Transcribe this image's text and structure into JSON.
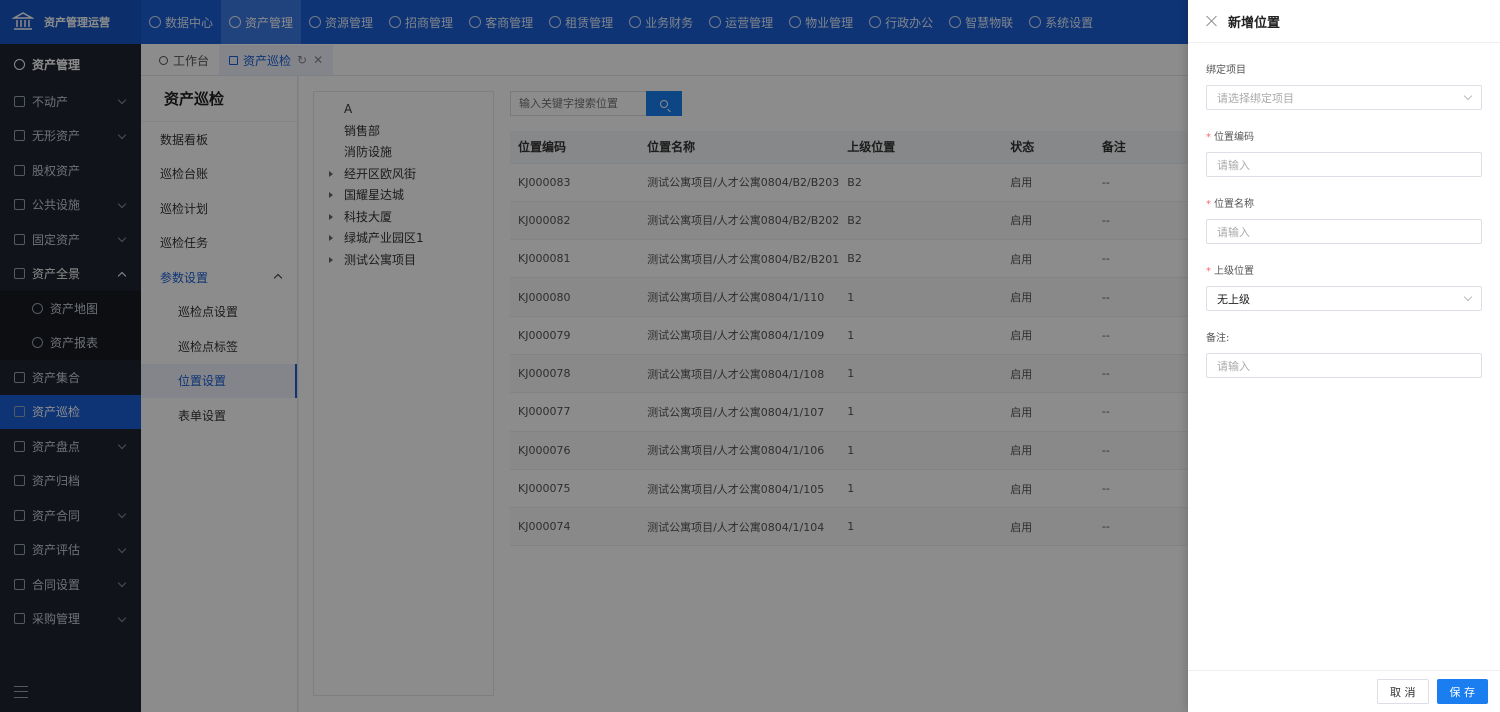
{
  "brand": "资产管理运营",
  "topnav": [
    "数据中心",
    "资产管理",
    "资源管理",
    "招商管理",
    "客商管理",
    "租赁管理",
    "业务财务",
    "运营管理",
    "物业管理",
    "行政办公",
    "智慧物联",
    "系统设置"
  ],
  "topnav_active": "资产管理",
  "sidebar": {
    "header": "资产管理",
    "items": [
      {
        "label": "不动产",
        "chev": true
      },
      {
        "label": "无形资产",
        "chev": true
      },
      {
        "label": "股权资产"
      },
      {
        "label": "公共设施",
        "chev": true
      },
      {
        "label": "固定资产",
        "chev": true
      },
      {
        "label": "资产全景",
        "chev": true,
        "open": true
      },
      {
        "label": "资产地图",
        "sub": true
      },
      {
        "label": "资产报表",
        "sub": true
      },
      {
        "label": "资产集合"
      },
      {
        "label": "资产巡检",
        "active": true
      },
      {
        "label": "资产盘点",
        "chev": true
      },
      {
        "label": "资产归档"
      },
      {
        "label": "资产合同",
        "chev": true
      },
      {
        "label": "资产评估",
        "chev": true
      },
      {
        "label": "合同设置",
        "chev": true
      },
      {
        "label": "采购管理",
        "chev": true
      }
    ]
  },
  "tabs": [
    {
      "label": "工作台"
    },
    {
      "label": "资产巡检",
      "active": true
    }
  ],
  "submenu": {
    "title": "资产巡检",
    "items": [
      {
        "label": "数据看板"
      },
      {
        "label": "巡检台账"
      },
      {
        "label": "巡检计划"
      },
      {
        "label": "巡检任务"
      },
      {
        "label": "参数设置",
        "group": true
      },
      {
        "label": "巡检点设置",
        "child": true
      },
      {
        "label": "巡检点标签",
        "child": true
      },
      {
        "label": "位置设置",
        "child": true,
        "active": true
      },
      {
        "label": "表单设置",
        "child": true
      }
    ]
  },
  "tree": [
    {
      "label": "A"
    },
    {
      "label": "销售部"
    },
    {
      "label": "消防设施"
    },
    {
      "label": "经开区欧风街",
      "exp": true
    },
    {
      "label": "国耀星达城",
      "exp": true
    },
    {
      "label": "科技大厦",
      "exp": true
    },
    {
      "label": "绿城产业园区1",
      "exp": true
    },
    {
      "label": "测试公寓项目",
      "exp": true
    }
  ],
  "search": {
    "placeholder": "输入关键字搜索位置"
  },
  "table": {
    "headers": [
      "位置编码",
      "位置名称",
      "上级位置",
      "状态",
      "备注"
    ],
    "rows": [
      [
        "KJ000083",
        "测试公寓项目/人才公寓0804/B2/B203",
        "B2",
        "启用",
        "--"
      ],
      [
        "KJ000082",
        "测试公寓项目/人才公寓0804/B2/B202",
        "B2",
        "启用",
        "--"
      ],
      [
        "KJ000081",
        "测试公寓项目/人才公寓0804/B2/B201",
        "B2",
        "启用",
        "--"
      ],
      [
        "KJ000080",
        "测试公寓项目/人才公寓0804/1/110",
        "1",
        "启用",
        "--"
      ],
      [
        "KJ000079",
        "测试公寓项目/人才公寓0804/1/109",
        "1",
        "启用",
        "--"
      ],
      [
        "KJ000078",
        "测试公寓项目/人才公寓0804/1/108",
        "1",
        "启用",
        "--"
      ],
      [
        "KJ000077",
        "测试公寓项目/人才公寓0804/1/107",
        "1",
        "启用",
        "--"
      ],
      [
        "KJ000076",
        "测试公寓项目/人才公寓0804/1/106",
        "1",
        "启用",
        "--"
      ],
      [
        "KJ000075",
        "测试公寓项目/人才公寓0804/1/105",
        "1",
        "启用",
        "--"
      ],
      [
        "KJ000074",
        "测试公寓项目/人才公寓0804/1/104",
        "1",
        "启用",
        "--"
      ]
    ]
  },
  "drawer": {
    "title": "新增位置",
    "fields": [
      {
        "label": "绑定项目",
        "placeholder": "请选择绑定项目",
        "select": true,
        "required": false
      },
      {
        "label": "位置编码",
        "placeholder": "请输入",
        "required": true
      },
      {
        "label": "位置名称",
        "placeholder": "请输入",
        "required": true
      },
      {
        "label": "上级位置",
        "value": "无上级",
        "select": true,
        "required": true
      },
      {
        "label": "备注:",
        "placeholder": "请输入",
        "required": false
      }
    ],
    "cancel": "取 消",
    "save": "保 存"
  },
  "colors": {
    "primary": "#1a5fd6",
    "button": "#1a7ef0",
    "sidebar": "#1f2430",
    "required": "#f56c6c"
  }
}
